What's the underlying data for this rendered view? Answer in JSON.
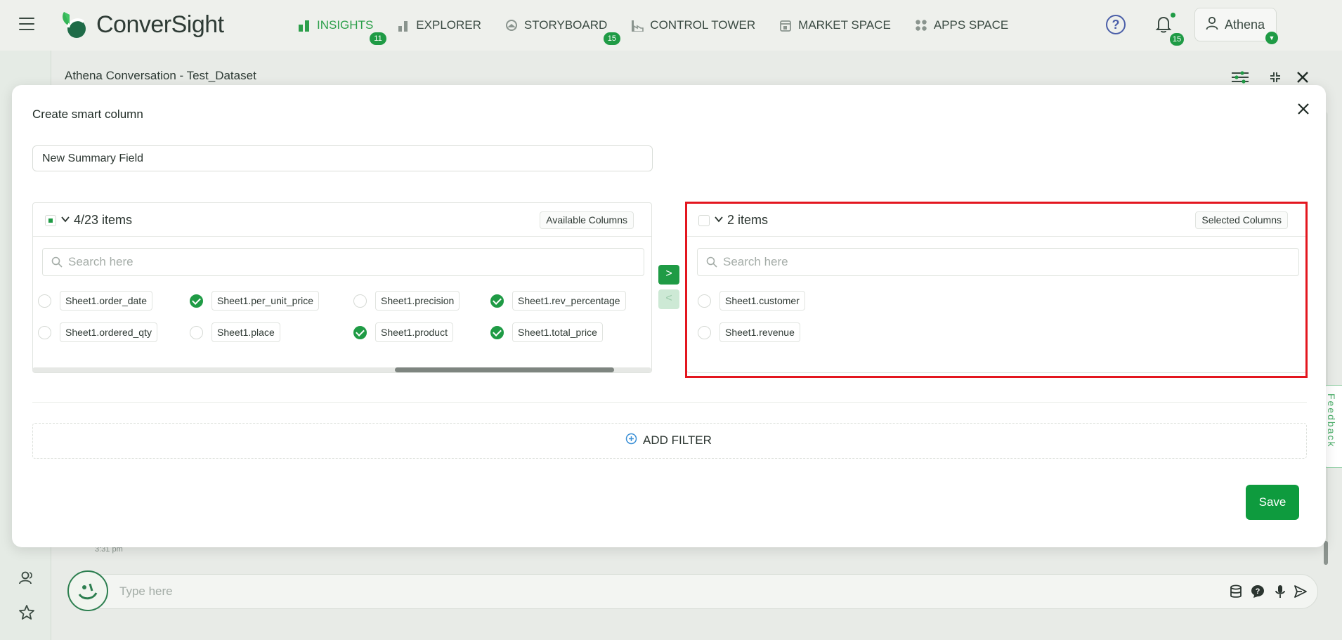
{
  "app": {
    "logo_text": "ConverSight",
    "brand_color": "#1f9b45",
    "accent_color": "#2c9f4a"
  },
  "nav": {
    "items": [
      {
        "label": "INSIGHTS",
        "icon": "bar-chart-icon",
        "badge": "11",
        "active": true
      },
      {
        "label": "EXPLORER",
        "icon": "bar-chart-small-icon",
        "badge": ""
      },
      {
        "label": "STORYBOARD",
        "icon": "storyboard-icon",
        "badge": "15"
      },
      {
        "label": "CONTROL TOWER",
        "icon": "factory-icon",
        "badge": ""
      },
      {
        "label": "MARKET SPACE",
        "icon": "store-icon",
        "badge": ""
      },
      {
        "label": "APPS SPACE",
        "icon": "apps-grid-icon",
        "badge": ""
      }
    ],
    "notifications_badge": "15",
    "user_name": "Athena"
  },
  "conversation": {
    "title": "Athena Conversation - Test_Dataset",
    "message_time": "3:31 pm",
    "input_placeholder": "Type here",
    "feedback_label": "Feedback"
  },
  "modal": {
    "title": "Create smart column",
    "name_value": "New Summary Field",
    "left_panel": {
      "count_label": "4/23 items",
      "tag": "Available Columns",
      "search_placeholder": "Search here",
      "items": [
        {
          "label": "Sheet1.order_date",
          "checked": false
        },
        {
          "label": "Sheet1.per_unit_price",
          "checked": true
        },
        {
          "label": "Sheet1.precision",
          "checked": false
        },
        {
          "label": "Sheet1.rev_percentage",
          "checked": true
        },
        {
          "label": "Sheet1.ordered_qty",
          "checked": false
        },
        {
          "label": "Sheet1.place",
          "checked": false
        },
        {
          "label": "Sheet1.product",
          "checked": true
        },
        {
          "label": "Sheet1.total_price",
          "checked": true
        }
      ]
    },
    "right_panel": {
      "count_label": "2 items",
      "tag": "Selected Columns",
      "search_placeholder": "Search here",
      "items": [
        {
          "label": "Sheet1.customer",
          "checked": false
        },
        {
          "label": "Sheet1.revenue",
          "checked": false
        }
      ]
    },
    "move_right_label": ">",
    "move_left_label": "<",
    "add_filter_label": "ADD FILTER",
    "save_label": "Save"
  }
}
